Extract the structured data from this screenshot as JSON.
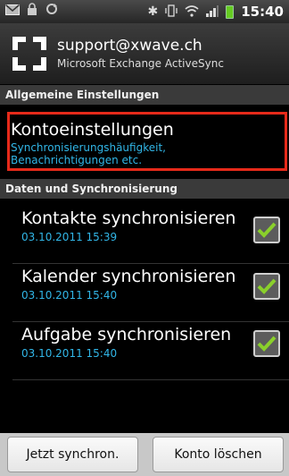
{
  "statusbar": {
    "left_icons": [
      "mail-icon",
      "lock-icon",
      "sync-icon"
    ],
    "right_icons": [
      "bluetooth-icon",
      "vibrate-icon",
      "wifi-icon",
      "signal-icon",
      "battery-icon"
    ],
    "time": "15:40"
  },
  "account": {
    "email": "support@xwave.ch",
    "type": "Microsoft Exchange ActiveSync",
    "icon": "exchange-logo-icon"
  },
  "sections": {
    "general": "Allgemeine Einstellungen",
    "data_sync": "Daten und Synchronisierung"
  },
  "account_settings": {
    "title": "Kontoeinstellungen",
    "subtitle_line1": "Synchronisierungshäufigkeit,",
    "subtitle_line2": "Benachrichtigungen etc.",
    "highlight_color": "#e62a1a"
  },
  "sync_items": [
    {
      "label": "Kontakte synchronisieren",
      "date": "03.10.2011 15:39",
      "checked": true
    },
    {
      "label": "Kalender synchronisieren",
      "date": "03.10.2011 15:40",
      "checked": true
    },
    {
      "label": "Aufgabe synchronisieren",
      "date": "03.10.2011 15:40",
      "checked": true
    }
  ],
  "buttons": {
    "sync_now": "Jetzt synchron.",
    "delete_account": "Konto löschen"
  },
  "colors": {
    "accent_blue": "#31b6e7",
    "check_green": "#8ad02b"
  }
}
